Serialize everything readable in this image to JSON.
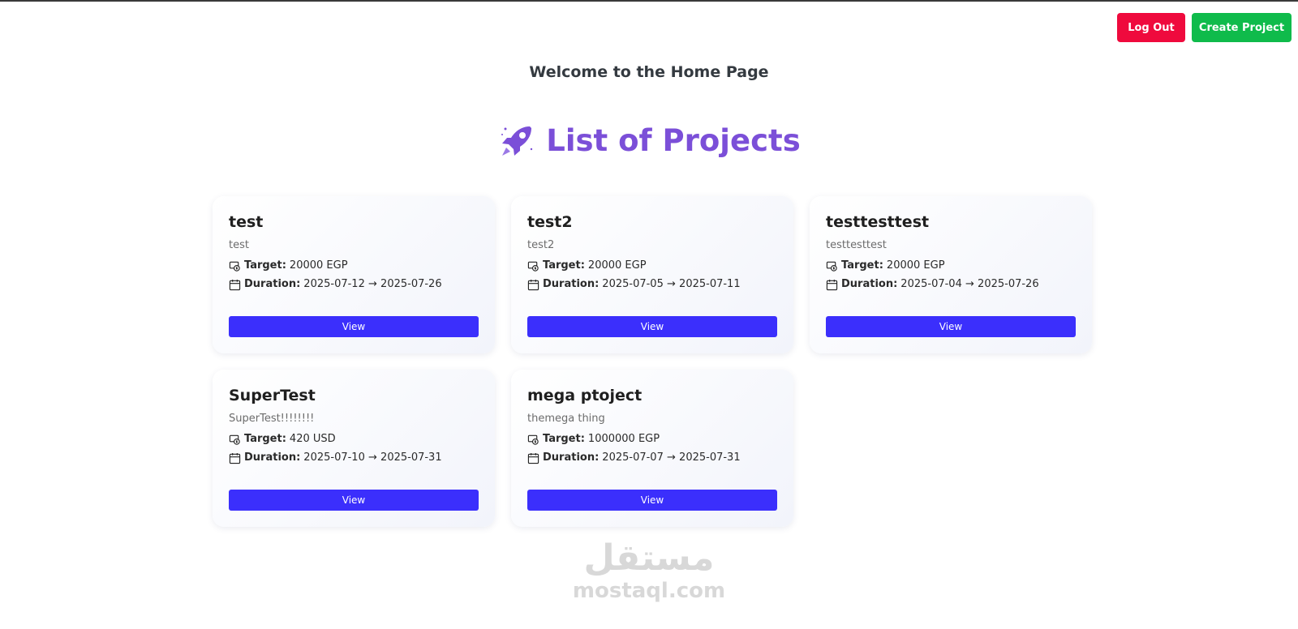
{
  "header": {
    "logout_label": "Log Out",
    "create_label": "Create Project"
  },
  "welcome": "Welcome to the Home Page",
  "list_title": "List of Projects",
  "labels": {
    "target": "Target:",
    "duration": "Duration:",
    "view": "View",
    "arrow": "→"
  },
  "projects": [
    {
      "name": "test",
      "description": "test",
      "target": "20000 EGP",
      "start": "2025-07-12",
      "end": "2025-07-26"
    },
    {
      "name": "test2",
      "description": "test2",
      "target": "20000 EGP",
      "start": "2025-07-05",
      "end": "2025-07-11"
    },
    {
      "name": "testtesttest",
      "description": "testtesttest",
      "target": "20000 EGP",
      "start": "2025-07-04",
      "end": "2025-07-26"
    },
    {
      "name": "SuperTest",
      "description": "SuperTest!!!!!!!!",
      "target": "420 USD",
      "start": "2025-07-10",
      "end": "2025-07-31"
    },
    {
      "name": "mega ptoject",
      "description": "themega thing",
      "target": "1000000 EGP",
      "start": "2025-07-07",
      "end": "2025-07-31"
    }
  ],
  "watermark": {
    "arabic": "مستقل",
    "latin": "mostaql.com"
  },
  "colors": {
    "logout": "#ef0a3d",
    "create": "#0fbb4b",
    "title_purple": "#7b4fd8",
    "view_button": "#3b2ffc"
  },
  "icons": {
    "title": "rocket-icon",
    "target": "money-icon",
    "duration": "calendar-icon"
  }
}
